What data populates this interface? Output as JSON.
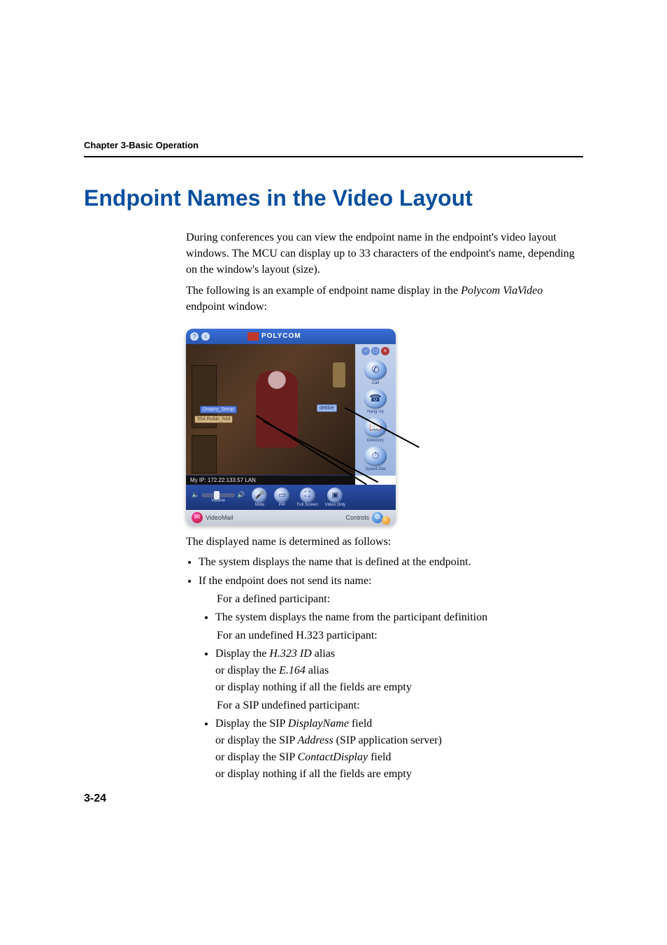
{
  "chapter_header": "Chapter 3-Basic Operation",
  "heading": "Endpoint Names in the Video Layout",
  "para1": "During conferences you can view the endpoint name in the endpoint's video layout windows. The MCU can display up to 33 characters of the endpoint's name, depending on the window's layout (size).",
  "para2_a": "The following is an example of endpoint name display in the ",
  "para2_italic": "Polycom ViaVideo",
  "para2_b": " endpoint window:",
  "figure": {
    "title": "POLYCOM",
    "ip_text": "My IP: 172.22.133.57 LAN",
    "label1": "Dropny_Setup",
    "label2": "554.Rubin_fold",
    "label3": "debbie",
    "sidebar": [
      {
        "name": "call",
        "label": "Call"
      },
      {
        "name": "hangup",
        "label": "Hang Up"
      },
      {
        "name": "directory",
        "label": "Directory"
      },
      {
        "name": "speeddial",
        "label": "Speed Dial"
      }
    ],
    "controls": [
      {
        "name": "volume",
        "label": "Volume"
      },
      {
        "name": "mute",
        "label": "Mute"
      },
      {
        "name": "pip",
        "label": "PIP"
      },
      {
        "name": "fullscreen",
        "label": "Full Screen"
      },
      {
        "name": "videoonly",
        "label": "Video Only"
      }
    ],
    "footer_left": "VideoMail",
    "footer_right": "Controls"
  },
  "para3": "The displayed name is determined as follows:",
  "bullets_l1": [
    "The system displays the name that is defined at the endpoint.",
    "If the endpoint does not send its name:"
  ],
  "subhead1": "For a defined participant:",
  "sub1_bullet": "The system displays the name from the participant definition",
  "subhead2": "For an undefined H.323 participant:",
  "sub2_bullet_a": "Display the ",
  "sub2_bullet_italic": "H.323 ID",
  "sub2_bullet_b": " alias",
  "sub2_or1_a": "or display the ",
  "sub2_or1_italic": "E.164",
  "sub2_or1_b": " alias",
  "sub2_or2": "or display nothing if all the fields are empty",
  "subhead3": "For a SIP undefined participant:",
  "sub3_bullet_a": "Display the SIP ",
  "sub3_bullet_italic": "DisplayName",
  "sub3_bullet_b": " field",
  "sub3_or1_a": "or display the SIP ",
  "sub3_or1_italic": "Address",
  "sub3_or1_b": " (SIP application server)",
  "sub3_or2_a": "or display the SIP ",
  "sub3_or2_italic": "ContactDisplay",
  "sub3_or2_b": " field",
  "sub3_or3": "or display nothing if all the fields are empty",
  "page_number": "3-24"
}
